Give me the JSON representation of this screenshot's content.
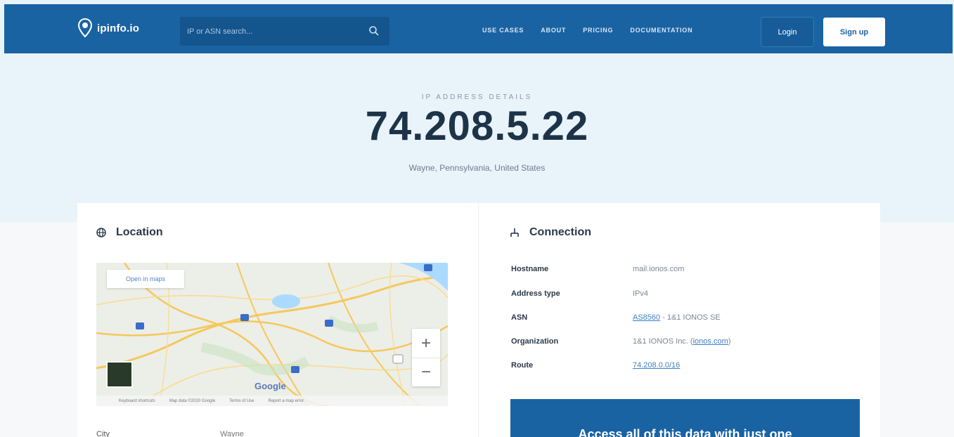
{
  "nav": {
    "brand": "ipinfo.io",
    "search_placeholder": "IP or ASN search...",
    "links": [
      "Use cases",
      "About",
      "Pricing",
      "Documentation"
    ],
    "login": "Login",
    "signup": "Sign up",
    "colors": {
      "nav_bg": "#1a63a3",
      "page_bg": "#e9f3fa"
    }
  },
  "hero": {
    "kicker": "IP Address Details",
    "ip": "74.208.5.22",
    "location": "Wayne, Pennsylvania, United States"
  },
  "location": {
    "title": "Location",
    "map_open_label": "Open in maps",
    "map_attribution": "Google",
    "map_footer": [
      "Keyboard shortcuts",
      "Map data ©2020 Google",
      "Terms of Use",
      "Report a map error"
    ],
    "city_label": "City",
    "city_value": "Wayne"
  },
  "connection": {
    "title": "Connection",
    "rows": [
      {
        "label": "Hostname",
        "value": "mail.ionos.com"
      },
      {
        "label": "Address type",
        "value": "IPv4"
      },
      {
        "label": "ASN",
        "link": "AS8560",
        "value": " - 1&1 IONOS SE"
      },
      {
        "label": "Organization",
        "value": "1&1 IONOS Inc. (",
        "link": "ionos.com",
        "value_end": ")"
      },
      {
        "label": "Route",
        "link": "74.208.0.0/16"
      }
    ]
  },
  "cta": {
    "text": "Access all of this data with just one"
  }
}
